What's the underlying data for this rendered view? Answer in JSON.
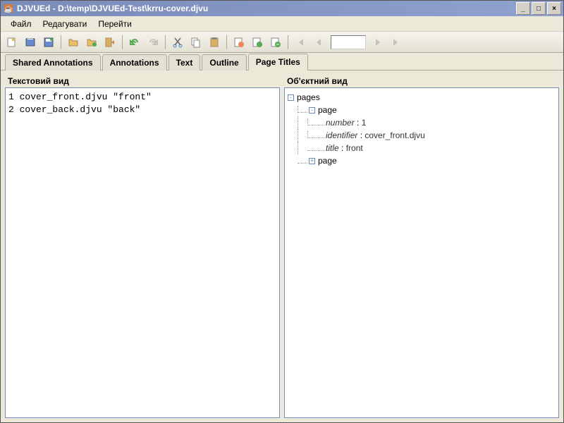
{
  "titlebar": {
    "title": "DJVUEd - D:\\temp\\DJVUEd-Test\\krru-cover.djvu"
  },
  "menu": {
    "file": "Файл",
    "edit": "Редагувати",
    "go": "Перейти"
  },
  "tabs": {
    "shared_annotations": "Shared Annotations",
    "annotations": "Annotations",
    "text": "Text",
    "outline": "Outline",
    "page_titles": "Page Titles"
  },
  "panels": {
    "text_view_header": "Текстовий вид",
    "object_view_header": "Об'єктний вид"
  },
  "text_view": {
    "lines": [
      "1 cover_front.djvu \"front\"",
      "2 cover_back.djvu \"back\""
    ]
  },
  "tree": {
    "root": "pages",
    "page1": "page",
    "page1_number_key": "number",
    "page1_number_val": "1",
    "page1_identifier_key": "identifier",
    "page1_identifier_val": "cover_front.djvu",
    "page1_title_key": "title",
    "page1_title_val": "front",
    "page2": "page"
  }
}
